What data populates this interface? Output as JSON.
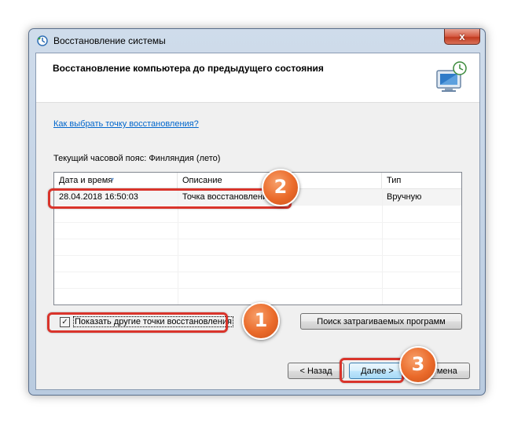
{
  "window": {
    "title": "Восстановление системы",
    "close_glyph": "x"
  },
  "header": {
    "title": "Восстановление компьютера до предыдущего состояния",
    "icon": "system-restore-computer-icon"
  },
  "help_link": "Как выбрать точку восстановления?",
  "timezone": "Текущий часовой пояс: Финляндия (лето)",
  "table": {
    "columns": [
      "Дата и время",
      "Описание",
      "Тип"
    ],
    "rows": [
      {
        "date": "28.04.2018 16:50:03",
        "description": "Точка восстановления",
        "type": "Вручную"
      }
    ]
  },
  "show_more": {
    "label": "Показать другие точки восстановления",
    "checked": true,
    "check_glyph": "✓"
  },
  "buttons": {
    "affected": "Поиск затрагиваемых программ",
    "back": "< Назад",
    "next": "Далее >",
    "cancel": "Отмена"
  },
  "badges": [
    "1",
    "2",
    "3"
  ],
  "colors": {
    "accent_link": "#0066cc",
    "highlight": "#d9342b",
    "badge": "#ea6a2a"
  }
}
